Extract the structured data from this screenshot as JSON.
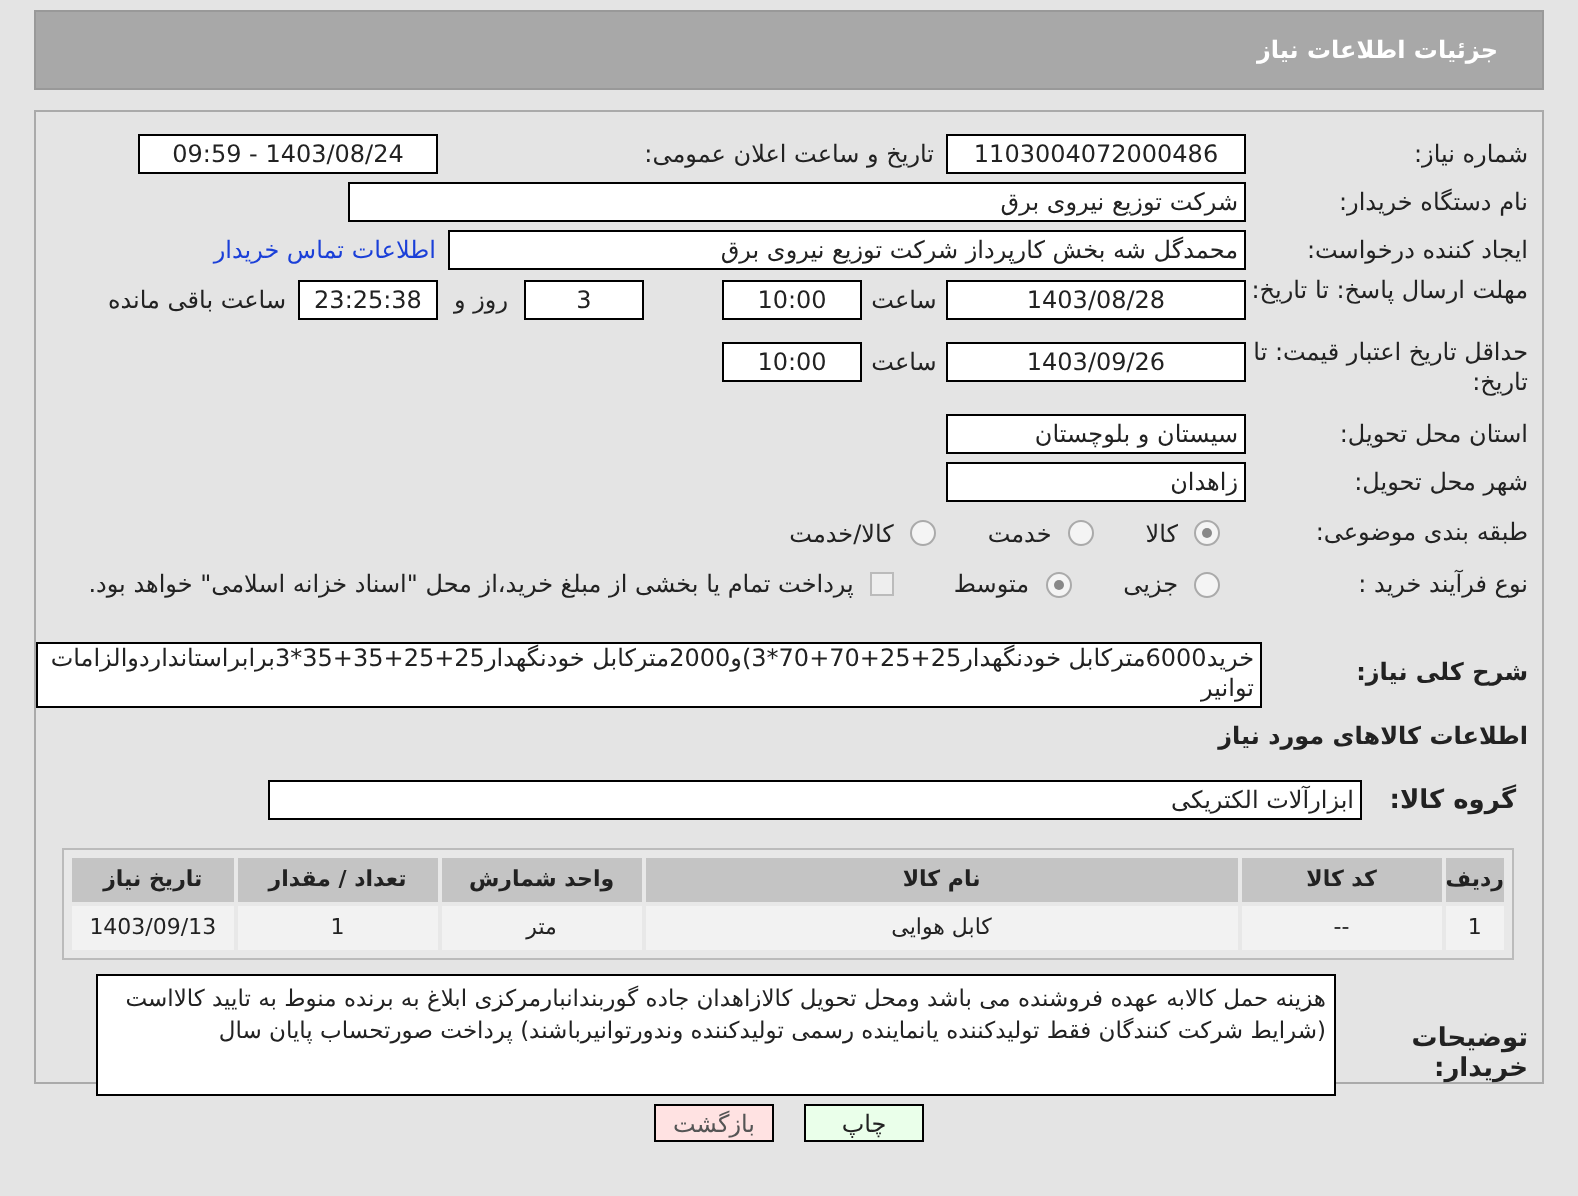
{
  "header": {
    "title": "جزئیات اطلاعات نیاز"
  },
  "need_number": {
    "label": "شماره نیاز:",
    "value": "1103004072000486"
  },
  "announce": {
    "label": "تاریخ و ساعت اعلان عمومی:",
    "value": "1403/08/24 - 09:59"
  },
  "buyer": {
    "label": "نام دستگاه خریدار:",
    "value": "شرکت توزیع نیروی برق"
  },
  "creator": {
    "label": "ایجاد کننده درخواست:",
    "value": "محمدگل شه بخش کارپرداز شرکت توزیع نیروی برق",
    "link": "اطلاعات تماس خریدار"
  },
  "reply_deadline": {
    "label": "مهلت ارسال پاسخ: تا تاریخ:",
    "date": "1403/08/28",
    "time_label": "ساعت",
    "time": "10:00",
    "days": "3",
    "days_label": "روز و",
    "remaining": "23:25:38",
    "remaining_label": "ساعت باقی مانده"
  },
  "price_validity": {
    "label": "حداقل تاریخ اعتبار قیمت: تا تاریخ:",
    "date": "1403/09/26",
    "time_label": "ساعت",
    "time": "10:00"
  },
  "province": {
    "label": "استان محل تحویل:",
    "value": "سیستان و بلوچستان"
  },
  "city": {
    "label": "شهر محل تحویل:",
    "value": "زاهدان"
  },
  "category": {
    "label": "طبقه بندی موضوعی:",
    "options": [
      {
        "label": "کالا",
        "selected": true
      },
      {
        "label": "خدمت",
        "selected": false
      },
      {
        "label": "کالا/خدمت",
        "selected": false
      }
    ]
  },
  "process": {
    "label": "نوع فرآیند خرید :",
    "options": [
      {
        "label": "جزیی",
        "selected": false
      },
      {
        "label": "متوسط",
        "selected": true
      }
    ],
    "treasury": {
      "checked": false,
      "text": "پرداخت تمام یا بخشی از مبلغ خرید،از محل \"اسناد خزانه اسلامی\" خواهد بود."
    }
  },
  "description": {
    "label": "شرح کلی نیاز:",
    "value": "خرید6000متركابل خودنگهدار25+25+70+70*3)و2000متركابل خودنگهدار25+25+35+35*3برابراستانداردوالزامات توانیر"
  },
  "goods_heading": "اطلاعات کالاهای مورد نیاز",
  "goods_group": {
    "label": "گروه کالا:",
    "value": "ابزارآلات الکتریکی"
  },
  "table": {
    "columns": [
      "ردیف",
      "کد کالا",
      "نام کالا",
      "واحد شمارش",
      "تعداد / مقدار",
      "تاریخ نیاز"
    ],
    "rows": [
      [
        "1",
        "--",
        "کابل هوایی",
        "متر",
        "1",
        "1403/09/13"
      ]
    ]
  },
  "notes": {
    "label": "توضیحات خریدار:",
    "value": "هزینه حمل کالابه عهده فروشنده می باشد ومحل تحویل کالازاهدان جاده گوربندانبارمرکزی  ابلاغ به برنده منوط به تایید کالااست (شرایط شرکت کنندگان فقط تولیدکننده یانماینده رسمی تولیدکننده وندورتوانیرباشند) پرداخت صورتحساب پایان سال"
  },
  "buttons": [
    {
      "label": "چاپ",
      "kind": "print"
    },
    {
      "label": "بازگشت",
      "kind": "back"
    }
  ]
}
